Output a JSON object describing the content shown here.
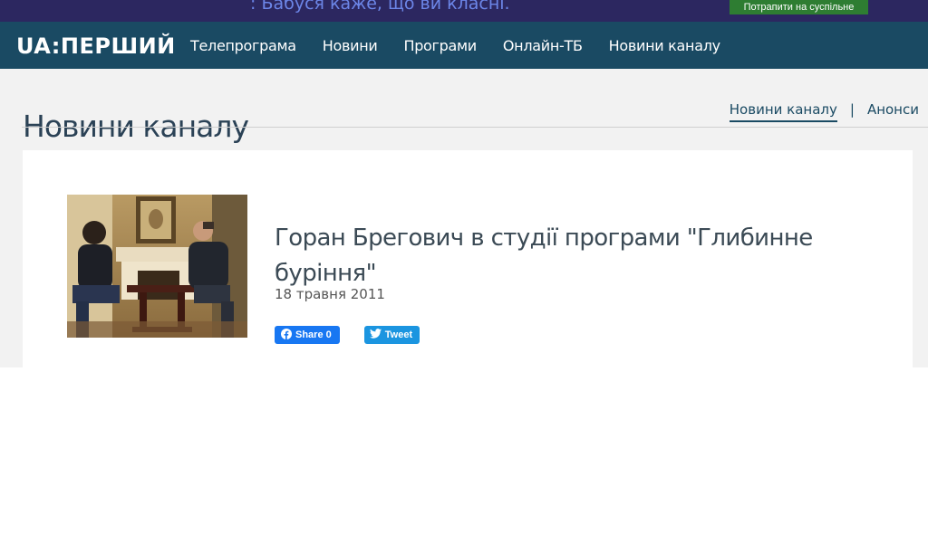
{
  "topbar": {
    "ticker_text": ": Бабуся каже, що ви класні.",
    "suspilne_button": "Потрапити на суспільне"
  },
  "navbar": {
    "logo": "UA:ПЕРШИЙ",
    "items": [
      "Телепрограма",
      "Новини",
      "Програми",
      "Онлайн-ТБ",
      "Новини каналу"
    ]
  },
  "page": {
    "title": "Новини каналу",
    "subnav": [
      {
        "label": "Новини каналу",
        "active": true
      },
      {
        "label": "Анонси",
        "active": false
      }
    ],
    "subnav_separator": "|"
  },
  "article": {
    "title": "Горан Брегович в студії програми \"Глибинне буріння\"",
    "date": "18 травня 2011",
    "facebook_label": "Share 0",
    "twitter_label": "Tweet"
  },
  "colors": {
    "topbar": "#2c2760",
    "navbar": "#1a4a63",
    "facebook": "#1877f2",
    "twitter": "#1b95e0",
    "suspilne": "#2e7d32"
  }
}
